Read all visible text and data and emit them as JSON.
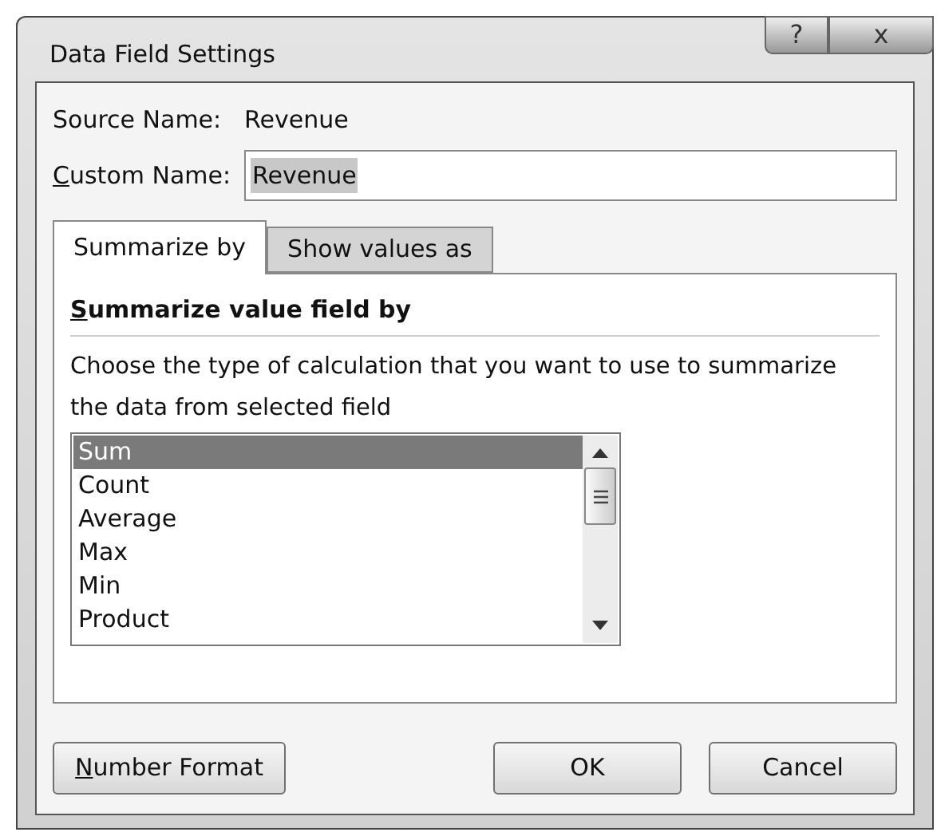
{
  "window": {
    "title": "Data Field Settings",
    "controls": [
      "?",
      "x"
    ]
  },
  "source_name": {
    "label": "Source Name:",
    "value": "Revenue"
  },
  "custom_name": {
    "label": "Custom Name:",
    "first_letter_underlined": true,
    "value": "Revenue"
  },
  "tabs": [
    {
      "label": "Summarize by",
      "selected": true
    },
    {
      "label": "Show values as",
      "selected": false
    }
  ],
  "section": {
    "heading": "Summarize value field by",
    "first_letter_underlined": true,
    "description": "Choose the type of calculation that you want to use to summarize the data from selected field"
  },
  "list": [
    {
      "label": "Sum",
      "selected": true
    },
    {
      "label": "Count",
      "selected": false
    },
    {
      "label": "Average",
      "selected": false
    },
    {
      "label": "Max",
      "selected": false
    },
    {
      "label": "Min",
      "selected": false
    },
    {
      "label": "Product",
      "selected": false
    }
  ],
  "buttons": [
    {
      "label": "Number Format",
      "first_letter_underlined": true,
      "kind": "left"
    },
    {
      "label": "OK",
      "kind": "right"
    },
    {
      "label": "Cancel",
      "kind": "right"
    }
  ]
}
